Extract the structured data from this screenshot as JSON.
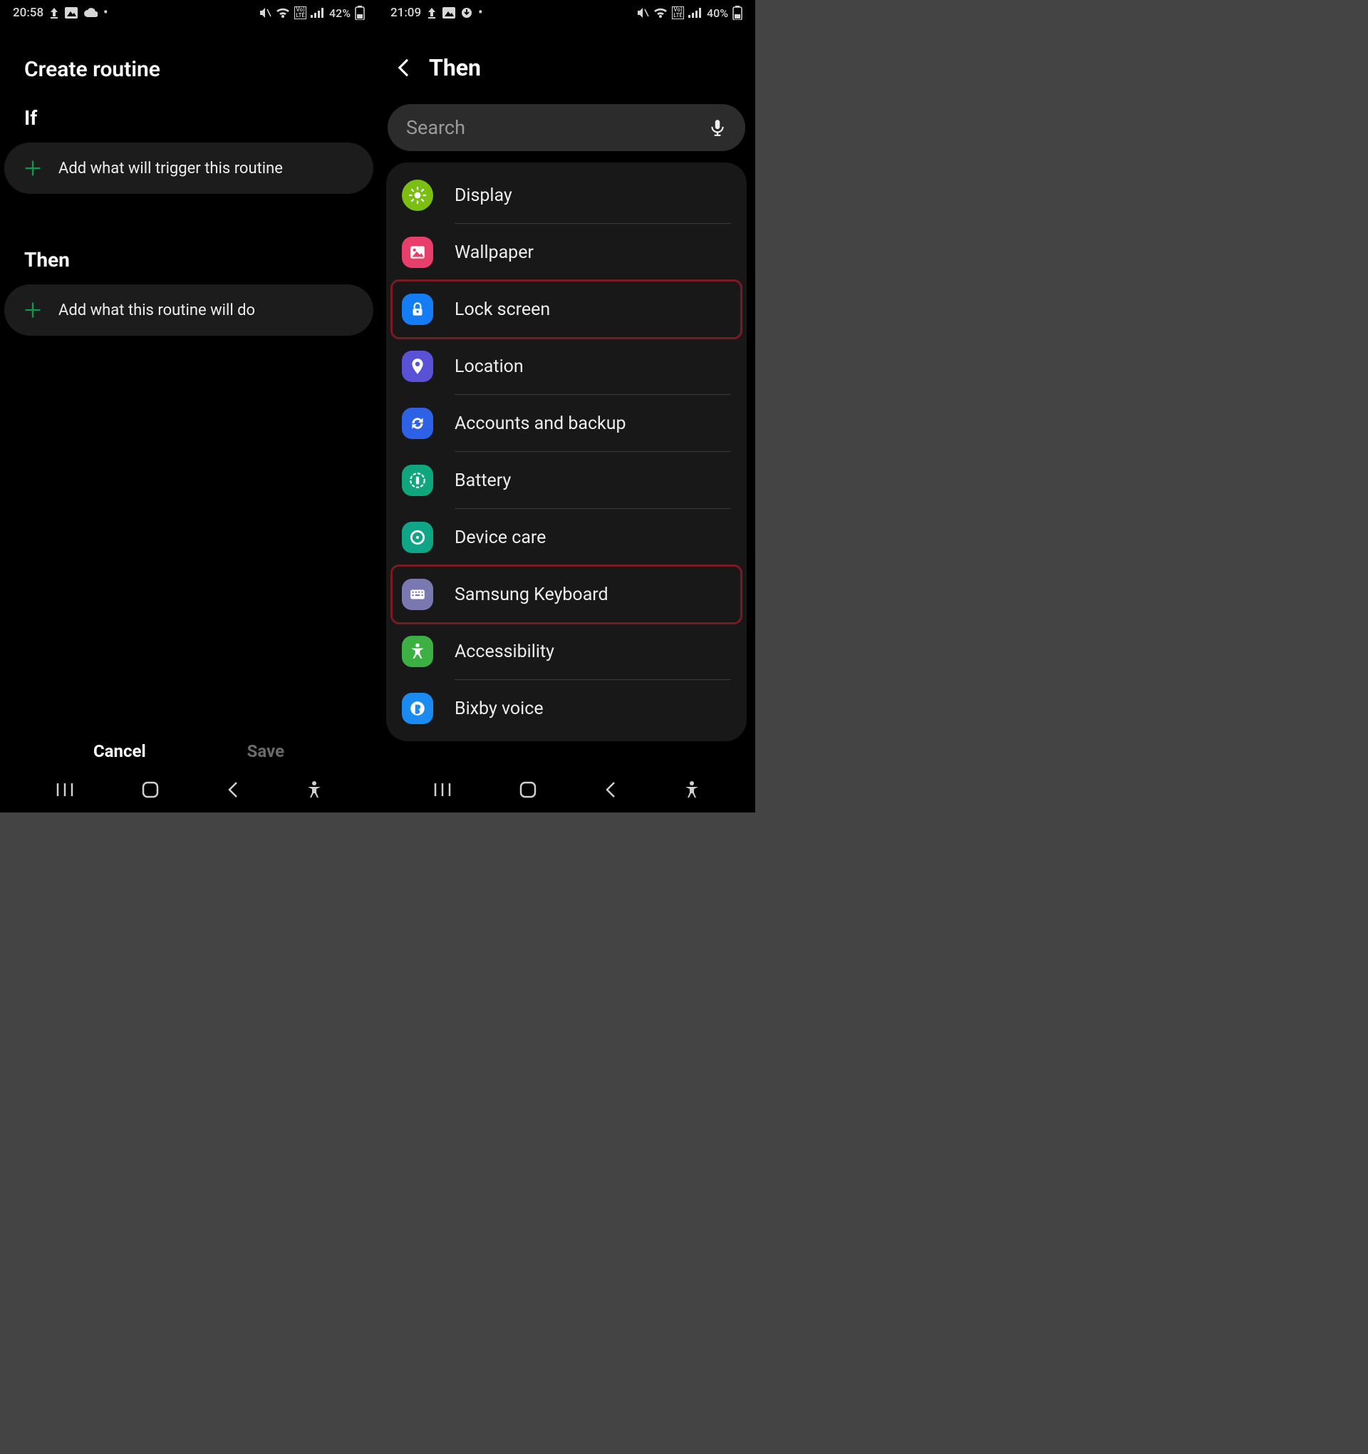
{
  "left": {
    "status": {
      "time": "20:58",
      "battery": "42%"
    },
    "title": "Create routine",
    "if_label": "If",
    "if_add": "Add what will trigger this routine",
    "then_label": "Then",
    "then_add": "Add what this routine will do",
    "cancel": "Cancel",
    "save": "Save"
  },
  "right": {
    "status": {
      "time": "21:09",
      "battery": "40%"
    },
    "title": "Then",
    "search_placeholder": "Search",
    "items": [
      {
        "label": "Display",
        "icon": "brightness-icon",
        "bg": "#7bbf12"
      },
      {
        "label": "Wallpaper",
        "icon": "picture-icon",
        "bg": "#e83e6b"
      },
      {
        "label": "Lock screen",
        "icon": "lock-icon",
        "bg": "#147df5",
        "highlight": true
      },
      {
        "label": "Location",
        "icon": "pin-icon",
        "bg": "#5a52d6"
      },
      {
        "label": "Accounts and backup",
        "icon": "sync-icon",
        "bg": "#2d62e6"
      },
      {
        "label": "Battery",
        "icon": "battery-icon",
        "bg": "#0fa67d"
      },
      {
        "label": "Device care",
        "icon": "devicecare-icon",
        "bg": "#0fa688"
      },
      {
        "label": "Samsung Keyboard",
        "icon": "keyboard-icon",
        "bg": "#7a78b0",
        "highlight": true
      },
      {
        "label": "Accessibility",
        "icon": "accessibility-icon",
        "bg": "#3cb043"
      },
      {
        "label": "Bixby voice",
        "icon": "bixby-icon",
        "bg": "#1a8bf0"
      }
    ]
  }
}
